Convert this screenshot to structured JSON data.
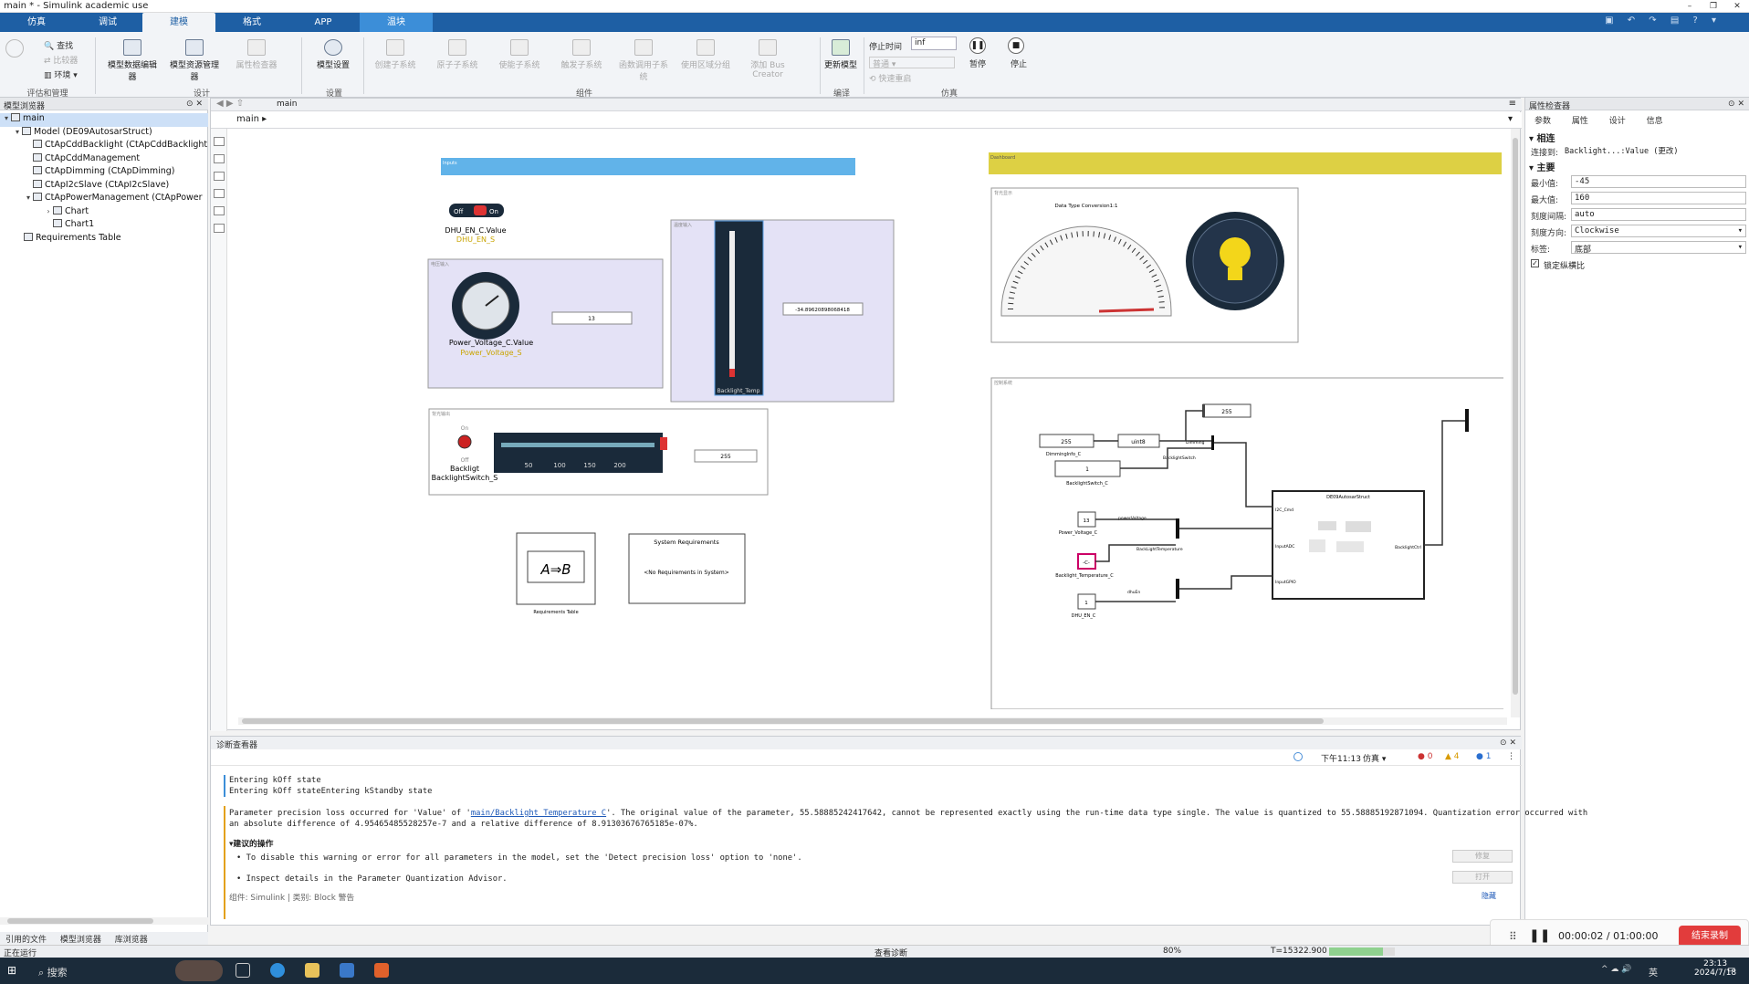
{
  "window": {
    "title": "main * - Simulink academic use",
    "buttons": [
      "–",
      "❐",
      "✕"
    ]
  },
  "ribbon_tabs": [
    "仿真",
    "调试",
    "建模",
    "格式",
    "APP",
    "温块"
  ],
  "ribbon": {
    "eval_items": [
      "查找",
      "比较器",
      "环境"
    ],
    "eval_group": "评估和管理",
    "model_data_editor": "模型数据编辑器",
    "model_explorer": "模型资源管理器",
    "prop_inspector": "属性检查器",
    "design_group": "设计",
    "model_settings": "模型设置",
    "settings_group": "设置",
    "subsystem_buttons": [
      "创建子系统",
      "原子子系统",
      "使能子系统",
      "触发子系统",
      "函数调用子系统",
      "使用区域分组",
      "添加 Bus Creator"
    ],
    "component_group": "组件",
    "update_model": "更新模型",
    "compile_group": "编译",
    "stop_time_label": "停止时间",
    "stop_time_value": "inf",
    "mode_label": "普通",
    "fast_restart": "快速重启",
    "pause_label": "暂停",
    "stop_label": "停止",
    "sim_group": "仿真"
  },
  "browser": {
    "title": "模型浏览器",
    "items": [
      {
        "label": "main"
      },
      {
        "label": "Model (DE09AutosarStruct)"
      },
      {
        "label": "CtApCddBacklight (CtApCddBacklight"
      },
      {
        "label": "CtApCddManagement"
      },
      {
        "label": "CtApDimming (CtApDimming)"
      },
      {
        "label": "CtApI2cSlave (CtApI2cSlave)"
      },
      {
        "label": "CtApPowerManagement (CtApPower"
      },
      {
        "label": "Chart"
      },
      {
        "label": "Chart1"
      },
      {
        "label": "Requirements Table"
      }
    ],
    "bottom_tabs": [
      "引用的文件",
      "模型浏览器",
      "库浏览器"
    ]
  },
  "canvas": {
    "tab": "main",
    "breadcrumb": "main",
    "dashboard_label": "Dashboard",
    "left_bar_label": "Inputs",
    "switch_off": "Off",
    "switch_on": "On",
    "switch_value": "DHU_EN_C.Value",
    "switch_signal": "DHU_EN_S",
    "gauge_panel_label": "电压输入",
    "knob_value": "Power_Voltage_C.Value",
    "knob_signal": "Power_Voltage_S",
    "knob_display": "13",
    "temp_panel_label": "温度输入",
    "temp_display": "-34.89620898068418",
    "temp_signal": "Backlight_Temp",
    "backlight_panel_label": "背光输出",
    "lamp_on": "On",
    "lamp_off": "Off",
    "lamp_name": "Backligt",
    "lamp_signal": "BacklightSwitch_S",
    "slider_display": "255",
    "speedo_panel_label": "背光显示",
    "speedo_title": "Data Type Conversion1:1",
    "control_panel_label": "控制系统",
    "req_table_caption": "Requirements Table",
    "req_table_formula": "A⇒B",
    "sys_req_title": "System Requirements",
    "sys_req_body": "<No Requirements in System>",
    "const_dimming": "255",
    "const_dimming_label": "DimmingInfo_C",
    "uint8_label": "uint8",
    "const_switch": "1",
    "const_switch_label": "BacklightSwitch_C",
    "const_voltage": "13",
    "const_voltage_label": "Power_Voltage_C",
    "const_temp": "-C-",
    "const_temp_label": "Backlight_Temperature_C",
    "const_dhu": "1",
    "const_dhu_label": "DHU_EN_C",
    "display_top": "255",
    "sig_dimming": "Dimming",
    "sig_backlight": "BacklightSwitch",
    "sig_voltage": "powerVoltage",
    "sig_temp": "BackLightTemperature",
    "sig_dhu": "dhuEn",
    "subsys_name": "DE09AutosarStruct",
    "port_i2c": "I2C_Cmd",
    "port_adc": "InputADC",
    "port_gpio": "InputGPIO",
    "port_out": "BacklightCtrl"
  },
  "inspector": {
    "title": "属性检查器",
    "tabs": [
      "参数",
      "属性",
      "设计",
      "信息"
    ],
    "section_connect": "相连",
    "connected_label": "连接到:",
    "connected_value": "Backlight...:Value (更改)",
    "section_main": "主要",
    "min_label": "最小值:",
    "min_value": "-45",
    "max_label": "最大值:",
    "max_value": "160",
    "tick_label": "刻度间隔:",
    "tick_value": "auto",
    "dir_label": "刻度方向:",
    "dir_value": "Clockwise",
    "tag_label": "标签:",
    "tag_value": "底部",
    "lock_label": "锁定纵横比"
  },
  "diagnostics": {
    "title": "诊断查看器",
    "time": "下午11:13",
    "mode": "仿真",
    "errors": "0",
    "warnings": "4",
    "infos": "1",
    "line1": "Entering kOff state",
    "line2": "Entering kOff stateEntering kStandby state",
    "warn_prefix": "Parameter precision loss occurred for 'Value' of '",
    "warn_link": "main/Backlight_Temperature_C",
    "warn_rest": "'. The original value of the parameter, 55.58885242417642, cannot be represented exactly using the run-time data type single. The value is quantized to 55.58885192871094. Quantization error occurred with",
    "warn_line2": "an absolute difference of 4.95465485528257e-7 and a relative difference of 8.91303676765185e-07%.",
    "suggest_title": "建议的操作",
    "suggest1": "To disable this warning or error for all parameters in the model, set the 'Detect precision loss' option to 'none'.",
    "suggest2": "Inspect details in the Parameter Quantization Advisor.",
    "fix_btn": "修复",
    "open_btn": "打开",
    "component_line": "组件: Simulink | 类别: Block 警告",
    "hide_link": "隐藏"
  },
  "status": {
    "left": "正在运行",
    "center": "查看诊断",
    "zoom": "80%",
    "time": "T=15322.900",
    "progress": 0.82
  },
  "recorder": {
    "elapsed": "00:00:02 / 01:00:00",
    "end_btn": "结束录制"
  },
  "taskbar": {
    "search": "搜索",
    "clock": "23:13",
    "date": "2024/7/18",
    "ime": "英"
  }
}
